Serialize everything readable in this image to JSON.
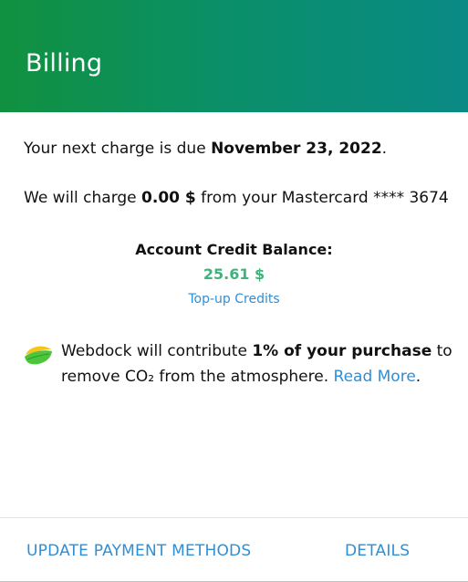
{
  "header": {
    "title": "Billing"
  },
  "next_charge": {
    "prefix": "Your next charge is due ",
    "date": "November 23, 2022",
    "suffix": "."
  },
  "charge_amount": {
    "prefix": "We will charge ",
    "amount": "0.00 $",
    "suffix": " from your Mastercard **** 3674"
  },
  "credit": {
    "label": "Account Credit Balance:",
    "value": "25.61 $",
    "topup_label": "Top-up Credits"
  },
  "co2": {
    "icon": "leaf-icon",
    "prefix": "Webdock will contribute ",
    "highlight": "1% of your purchase",
    "middle": " to remove CO₂ from the atmosphere. ",
    "link": "Read More",
    "suffix": "."
  },
  "footer": {
    "update_label": "UPDATE PAYMENT METHODS",
    "details_label": "DETAILS"
  },
  "colors": {
    "header_gradient_start": "#11913f",
    "header_gradient_end": "#0a8a85",
    "balance_green": "#3fb37a",
    "link_blue": "#2e8fd6"
  }
}
